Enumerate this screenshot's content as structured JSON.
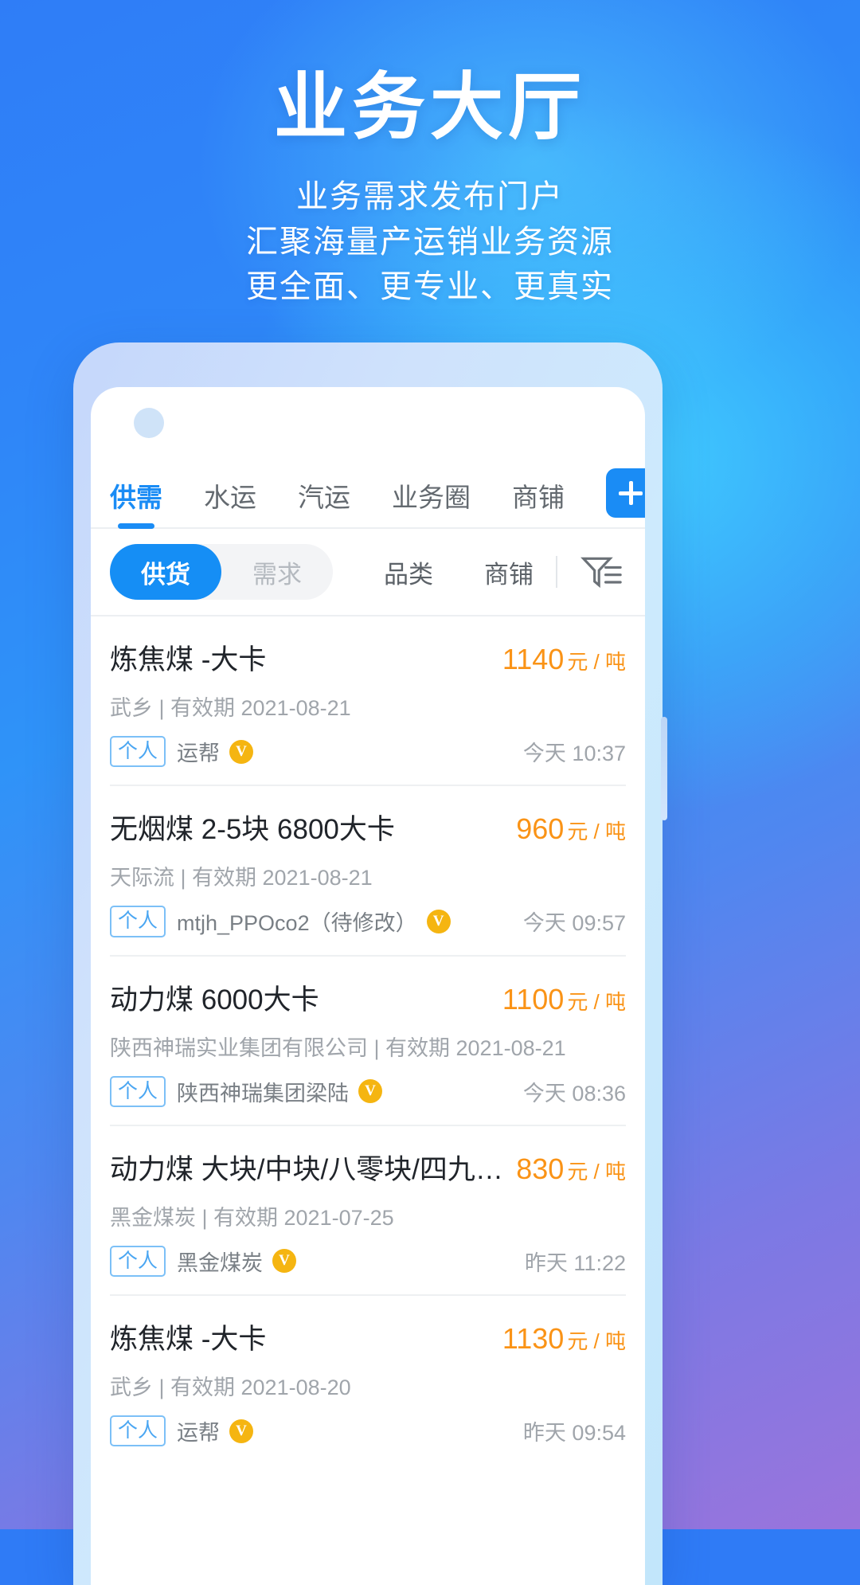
{
  "hero": {
    "title": "业务大厅",
    "subtitle_lines": [
      "业务需求发布门户",
      "汇聚海量产运销业务资源",
      "更全面、更专业、更真实"
    ]
  },
  "colors": {
    "accent_blue": "#1a8cf5",
    "price_orange": "#fa9316",
    "badge_blue": "#4aa6f2",
    "verified_gold": "#f5b511"
  },
  "app": {
    "tabs": [
      {
        "label": "供需",
        "active": true
      },
      {
        "label": "水运",
        "active": false
      },
      {
        "label": "汽运",
        "active": false
      },
      {
        "label": "业务圈",
        "active": false
      },
      {
        "label": "商铺",
        "active": false
      }
    ],
    "add_button": {
      "icon": "plus-icon"
    },
    "filter": {
      "segments": [
        {
          "label": "供货",
          "active": true
        },
        {
          "label": "需求",
          "active": false
        }
      ],
      "options": [
        "品类",
        "商铺"
      ],
      "filter_icon": "filter-funnel-icon"
    },
    "listings": [
      {
        "title": "炼焦煤  -大卡",
        "price": "1140",
        "unit": "元 / 吨",
        "meta": "武乡 | 有效期 2021-08-21",
        "badge": "个人",
        "owner": "运帮",
        "verified": "V",
        "time": "今天 10:37"
      },
      {
        "title": "无烟煤 2-5块 6800大卡",
        "price": "960",
        "unit": "元 / 吨",
        "meta": "天际流 | 有效期 2021-08-21",
        "badge": "个人",
        "owner": "mtjh_PPOco2（待修改）",
        "verified": "V",
        "time": "今天 09:57"
      },
      {
        "title": "动力煤  6000大卡",
        "price": "1100",
        "unit": "元 / 吨",
        "meta": "陕西神瑞实业集团有限公司 | 有效期 2021-08-21",
        "badge": "个人",
        "owner": "陕西神瑞集团梁陆",
        "verified": "V",
        "time": "今天 08:36"
      },
      {
        "title": "动力煤 大块/中块/八零块/四九块...",
        "price": "830",
        "unit": "元 / 吨",
        "meta": "黑金煤炭 | 有效期 2021-07-25",
        "badge": "个人",
        "owner": "黑金煤炭",
        "verified": "V",
        "time": "昨天 11:22"
      },
      {
        "title": "炼焦煤  -大卡",
        "price": "1130",
        "unit": "元 / 吨",
        "meta": "武乡 | 有效期 2021-08-20",
        "badge": "个人",
        "owner": "运帮",
        "verified": "V",
        "time": "昨天 09:54"
      }
    ]
  }
}
